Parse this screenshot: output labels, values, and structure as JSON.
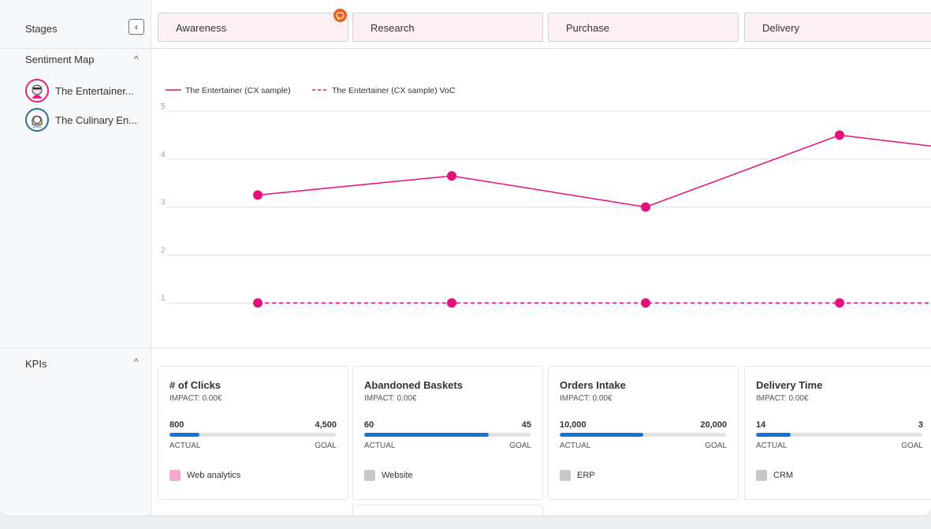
{
  "stages": {
    "label": "Stages",
    "collapse_icon": "‹",
    "items": [
      "Awareness",
      "Research",
      "Purchase",
      "Delivery"
    ],
    "comment_icon": "speech-bubble"
  },
  "sentiment": {
    "title": "Sentiment Map",
    "caret": "^",
    "personas": [
      {
        "name": "The Entertainer...",
        "ring": "#e6207f"
      },
      {
        "name": "The Culinary En...",
        "ring": "#2a6f97"
      }
    ]
  },
  "kpis": {
    "title": "KPIs",
    "caret": "^",
    "cards": [
      {
        "title": "# of Clicks",
        "impact": "IMPACT: 0.00€",
        "actual": "800",
        "goal": "4,500",
        "progress": 0.18,
        "actual_label": "ACTUAL",
        "goal_label": "GOAL",
        "source": "Web analytics",
        "source_color": "#f7a8cd"
      },
      {
        "title": "Abandoned Baskets",
        "impact": "IMPACT: 0.00€",
        "actual": "60",
        "goal": "45",
        "progress": 0.75,
        "actual_label": "ACTUAL",
        "goal_label": "GOAL",
        "source": "Website",
        "source_color": "#c8c8c8"
      },
      {
        "title": "Orders Intake",
        "impact": "IMPACT: 0.00€",
        "actual": "10,000",
        "goal": "20,000",
        "progress": 0.5,
        "actual_label": "ACTUAL",
        "goal_label": "GOAL",
        "source": "ERP",
        "source_color": "#c8c8c8"
      },
      {
        "title": "Delivery Time",
        "impact": "IMPACT: 0.00€",
        "actual": "14",
        "goal": "3",
        "progress": 0.21,
        "actual_label": "ACTUAL",
        "goal_label": "GOAL",
        "source": "CRM",
        "source_color": "#c8c8c8"
      }
    ]
  },
  "colors": {
    "accent": "#e6107d",
    "progress": "#1572db"
  },
  "chart_data": {
    "type": "line",
    "categories": [
      "Awareness",
      "Research",
      "Purchase",
      "Delivery",
      ""
    ],
    "ylim": [
      0,
      5
    ],
    "yticks": [
      "1",
      "2",
      "3",
      "4",
      "5"
    ],
    "grid": true,
    "legend_position": "top-left",
    "series": [
      {
        "name": "The Entertainer (CX sample)",
        "values": [
          3.25,
          3.65,
          3.0,
          4.5,
          4.25
        ],
        "style": "solid",
        "color": "#e6107d"
      },
      {
        "name": "The Entertainer (CX sample) VoC",
        "values": [
          1,
          1,
          1,
          1,
          null
        ],
        "style": "dashed",
        "color": "#e6107d"
      }
    ]
  }
}
